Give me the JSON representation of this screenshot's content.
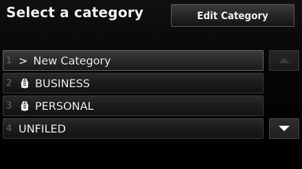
{
  "header": {
    "title": "Select a category",
    "edit_button_label": "Edit Category"
  },
  "list": {
    "items": [
      {
        "number": "1",
        "prefix": ">",
        "label": "New Category",
        "icon": null,
        "selected": true
      },
      {
        "number": "2",
        "prefix": "",
        "label": "BUSINESS",
        "icon": "briefcase-tag-icon",
        "selected": false
      },
      {
        "number": "3",
        "prefix": "",
        "label": "PERSONAL",
        "icon": "briefcase-tag-icon",
        "selected": false
      },
      {
        "number": "4",
        "prefix": "",
        "label": "UNFILED",
        "icon": null,
        "selected": false
      }
    ]
  },
  "scroll": {
    "up_enabled": false,
    "down_enabled": true,
    "up_icon": "triangle-up-icon",
    "down_icon": "triangle-down-icon"
  },
  "colors": {
    "background": "#000000",
    "text": "#f0f0f0",
    "disabled_arrow": "#3a3a3a",
    "number_text": "#6a6a6a"
  }
}
